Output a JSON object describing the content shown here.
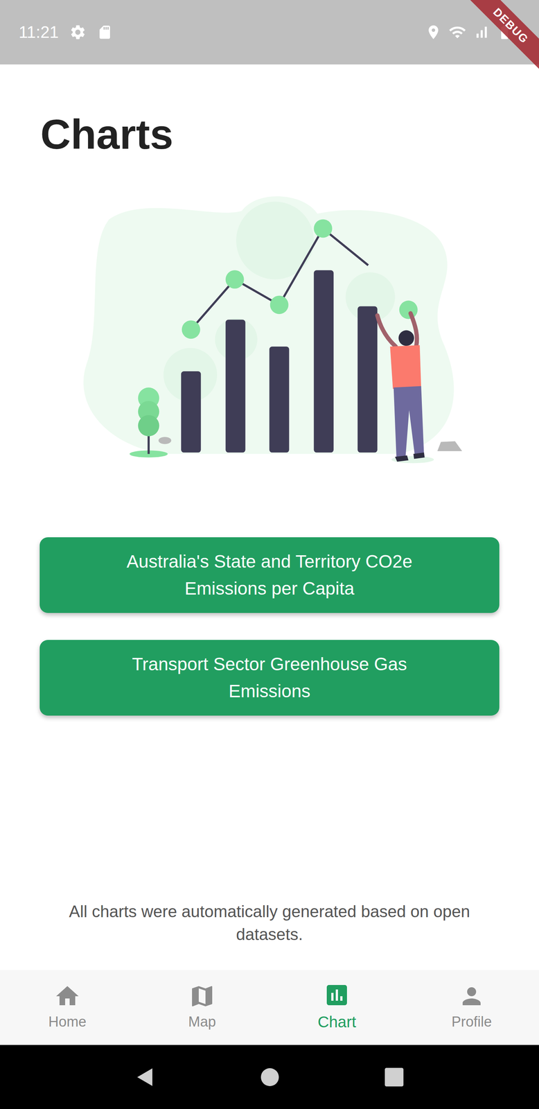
{
  "status_bar": {
    "time": "11:21"
  },
  "debug_banner": {
    "label": "DEBUG"
  },
  "page": {
    "title": "Charts"
  },
  "chart_buttons": [
    {
      "label": "Australia's State and Territory CO2e Emissions per Capita"
    },
    {
      "label": "Transport Sector Greenhouse Gas Emissions"
    }
  ],
  "footer": {
    "text": "All charts were automatically generated based on open datasets."
  },
  "bottom_nav": [
    {
      "label": "Home",
      "selected": false
    },
    {
      "label": "Map",
      "selected": false
    },
    {
      "label": "Chart",
      "selected": true
    },
    {
      "label": "Profile",
      "selected": false
    }
  ]
}
